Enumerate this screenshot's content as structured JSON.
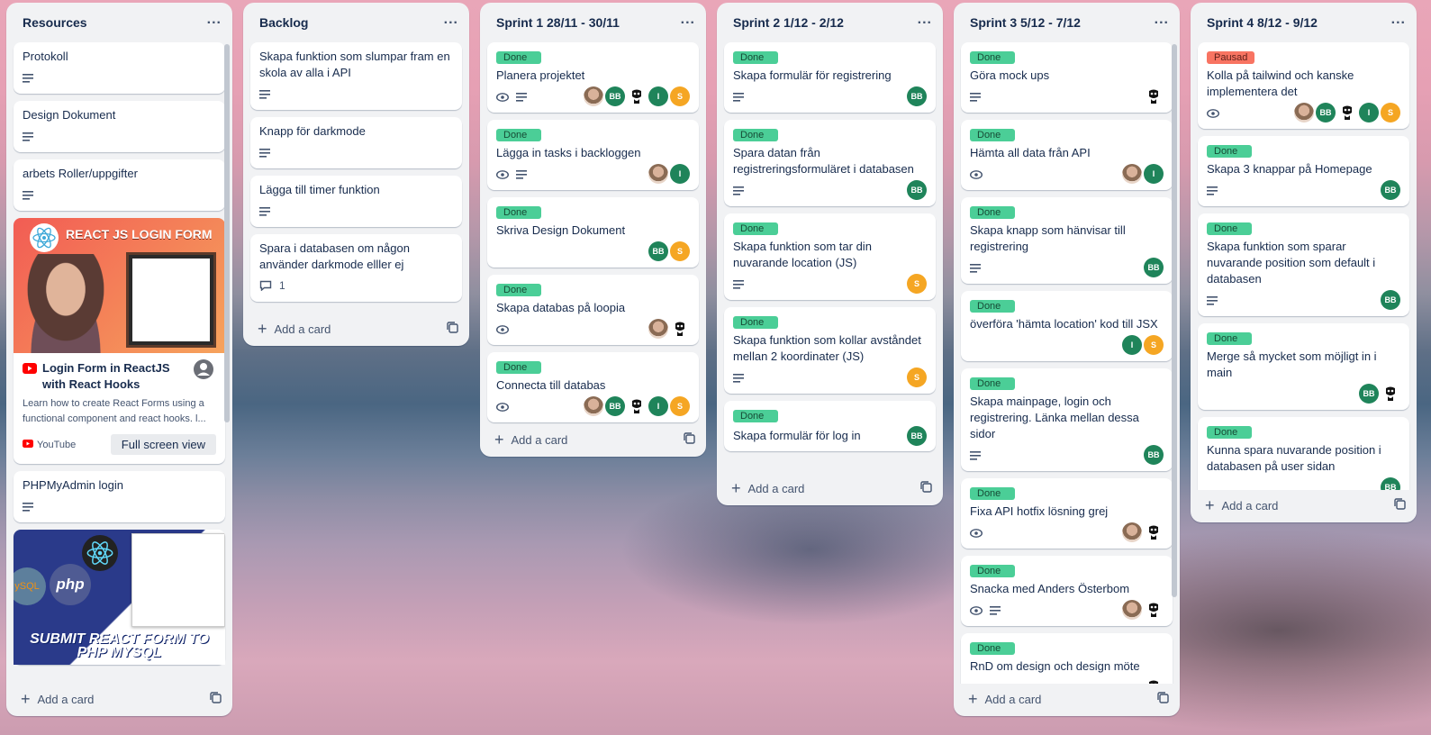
{
  "lists": [
    {
      "title": "Resources",
      "cards": [
        {
          "title": "Protokoll",
          "desc": true
        },
        {
          "title": "Design Dokument",
          "desc": true
        },
        {
          "title": "arbets Roller/uppgifter",
          "desc": true
        },
        {
          "type": "youtube",
          "cover_title": "REACT JS LOGIN FORM",
          "title": "Login Form in ReactJS with React Hooks",
          "desc_text": "Learn how to create React Forms using a functional component and react hooks. l...",
          "source": "YouTube",
          "button": "Full screen view"
        },
        {
          "title": "PHPMyAdmin login",
          "desc": true
        },
        {
          "type": "cover",
          "cover_text": "SUBMIT REACT FORM TO PHP MYSQL",
          "php": "php",
          "mysql": "ySQL"
        }
      ],
      "add": "Add a card"
    },
    {
      "title": "Backlog",
      "cards": [
        {
          "title": "Skapa funktion som slumpar fram en skola av alla i API",
          "desc": true
        },
        {
          "title": "Knapp för darkmode",
          "desc": true
        },
        {
          "title": "Lägga till timer funktion",
          "desc": true
        },
        {
          "title": "Spara i databasen om någon använder darkmode elller ej",
          "comments": "1"
        }
      ],
      "add": "Add a card"
    },
    {
      "title": "Sprint 1 28/11 - 30/11",
      "cards": [
        {
          "label": "Done",
          "title": "Planera projektet",
          "watch": true,
          "desc": true,
          "members": [
            "photo",
            "BB",
            "mask",
            "I",
            "S"
          ]
        },
        {
          "label": "Done",
          "title": "Lägga in tasks i backloggen",
          "watch": true,
          "desc": true,
          "members": [
            "photo",
            "I"
          ]
        },
        {
          "label": "Done",
          "title": "Skriva Design Dokument",
          "members": [
            "BB",
            "S"
          ]
        },
        {
          "label": "Done",
          "title": "Skapa databas på loopia",
          "watch": true,
          "members": [
            "photo",
            "mask"
          ]
        },
        {
          "label": "Done",
          "title": "Connecta till databas",
          "watch": true,
          "members": [
            "photo",
            "BB",
            "mask",
            "I",
            "S"
          ]
        }
      ],
      "add": "Add a card"
    },
    {
      "title": "Sprint 2 1/12 - 2/12",
      "cards": [
        {
          "label": "Done",
          "title": "Skapa formulär för registrering",
          "desc": true,
          "members": [
            "BB"
          ]
        },
        {
          "label": "Done",
          "title": "Spara datan från registreringsformuläret i databasen",
          "desc": true,
          "members": [
            "BB"
          ]
        },
        {
          "label": "Done",
          "title": "Skapa funktion som tar din nuvarande location (JS)",
          "desc": true,
          "members": [
            "S"
          ]
        },
        {
          "label": "Done",
          "title": "Skapa funktion som kollar avståndet mellan 2 koordinater (JS)",
          "desc": true,
          "members": [
            "S"
          ]
        },
        {
          "label": "Done",
          "title": "Skapa formulär för log in",
          "members": [
            "BB"
          ],
          "inline": true
        }
      ],
      "add": "Add a card"
    },
    {
      "title": "Sprint 3 5/12 - 7/12",
      "cards": [
        {
          "label": "Done",
          "title": "Göra mock ups",
          "desc": true,
          "members": [
            "mask"
          ]
        },
        {
          "label": "Done",
          "title": "Hämta all data från API",
          "watch": true,
          "members": [
            "photo",
            "I"
          ]
        },
        {
          "label": "Done",
          "title": "Skapa knapp som hänvisar till registrering",
          "desc": true,
          "members": [
            "BB"
          ]
        },
        {
          "label": "Done",
          "title": "överföra 'hämta location' kod till JSX",
          "members": [
            "I",
            "S"
          ]
        },
        {
          "label": "Done",
          "title": "Skapa mainpage, login och registrering. Länka mellan dessa sidor",
          "desc": true,
          "members": [
            "BB"
          ]
        },
        {
          "label": "Done",
          "title": "Fixa API hotfix lösning grej",
          "watch": true,
          "members": [
            "photo",
            "mask"
          ]
        },
        {
          "label": "Done",
          "title": "Snacka med Anders Österbom",
          "watch": true,
          "desc": true,
          "members": [
            "photo",
            "mask"
          ]
        },
        {
          "label": "Done",
          "title": "RnD om design och design möte",
          "members": [
            "mask"
          ]
        }
      ],
      "add": "Add a card"
    },
    {
      "title": "Sprint 4 8/12 - 9/12",
      "cards": [
        {
          "label": "Pausad",
          "paused": true,
          "title": "Kolla på tailwind och kanske implementera det",
          "watch": true,
          "members": [
            "photo",
            "BB",
            "mask",
            "I",
            "S"
          ]
        },
        {
          "label": "Done",
          "title": "Skapa 3 knappar på Homepage",
          "desc": true,
          "members": [
            "BB"
          ]
        },
        {
          "label": "Done",
          "title": "Skapa funktion som sparar nuvarande position som default i databasen",
          "desc": true,
          "members": [
            "BB"
          ]
        },
        {
          "label": "Done",
          "title": "Merge så mycket som möjligt in i main",
          "members": [
            "BB",
            "mask"
          ]
        },
        {
          "label": "Done",
          "title": "Kunna spara nuvarande position i databasen på user sidan",
          "members": [
            "BB"
          ]
        }
      ],
      "add": "Add a card"
    }
  ]
}
